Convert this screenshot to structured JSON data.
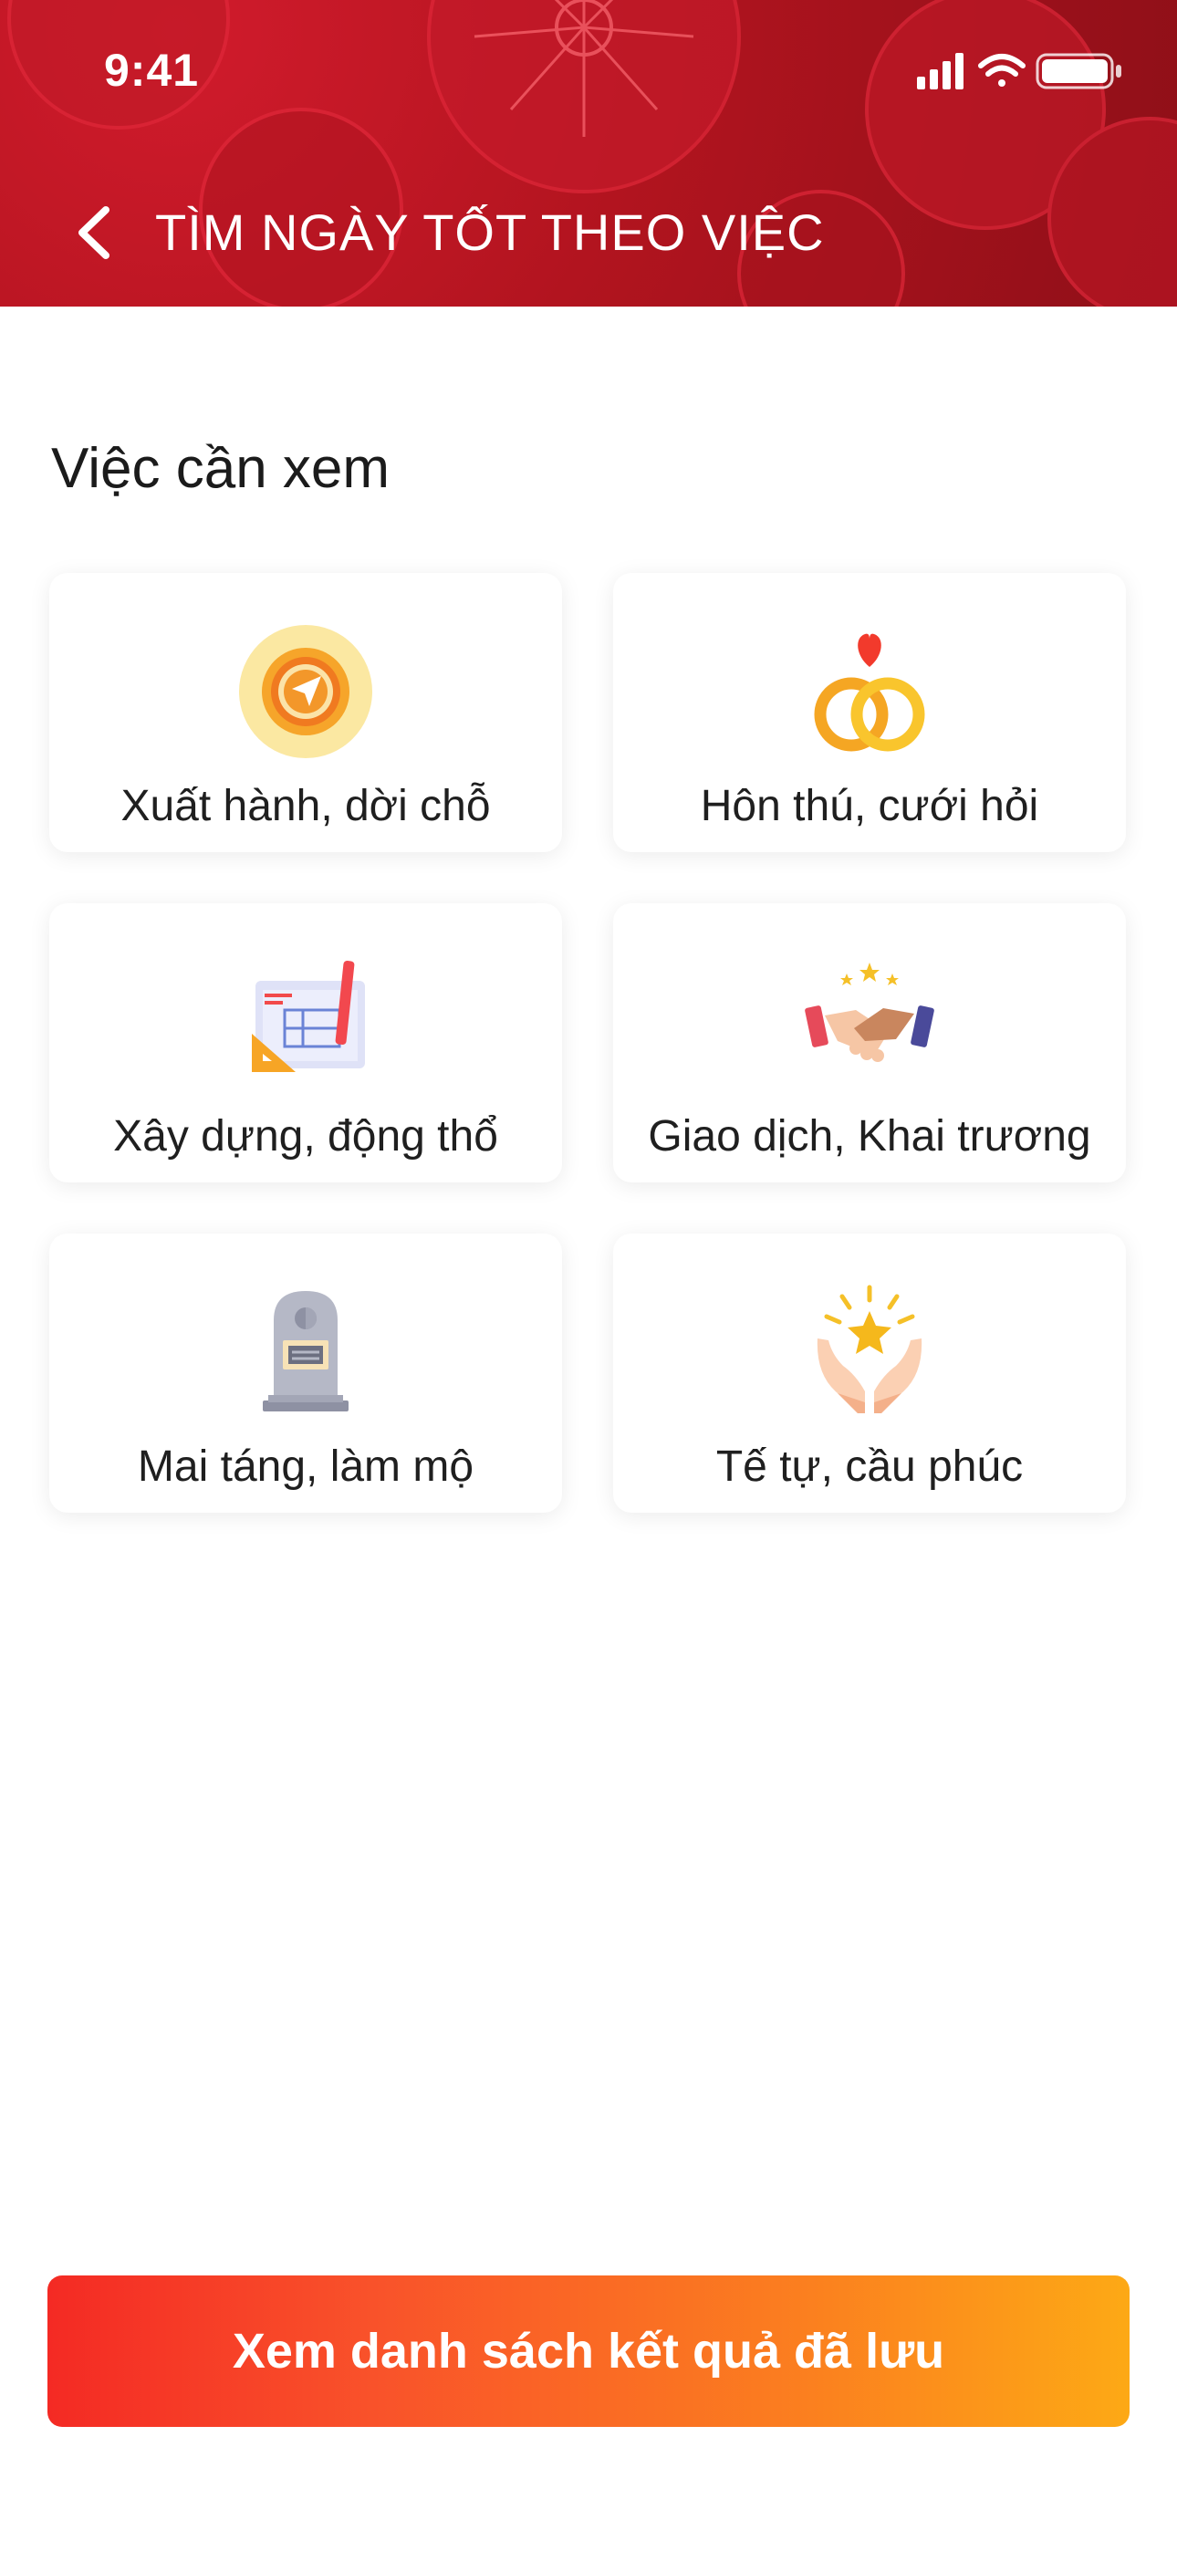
{
  "status_bar": {
    "time": "9:41"
  },
  "header": {
    "title": "TÌM NGÀY TỐT THEO VIỆC"
  },
  "section": {
    "title": "Việc cần xem"
  },
  "categories": [
    {
      "label": "Xuất hành, dời chỗ",
      "icon": "compass-icon"
    },
    {
      "label": "Hôn thú, cưới hỏi",
      "icon": "wedding-rings-icon"
    },
    {
      "label": "Xây dựng, động thổ",
      "icon": "blueprint-icon"
    },
    {
      "label": "Giao dịch, Khai trương",
      "icon": "handshake-icon"
    },
    {
      "label": "Mai táng, làm mộ",
      "icon": "tombstone-icon"
    },
    {
      "label": "Tế tự, cầu phúc",
      "icon": "prayer-hands-icon"
    }
  ],
  "cta": {
    "label": "Xem danh sách kết quả đã lưu"
  },
  "colors": {
    "header_red": "#b2141f",
    "cta_start": "#f42a24",
    "cta_end": "#fda915"
  }
}
